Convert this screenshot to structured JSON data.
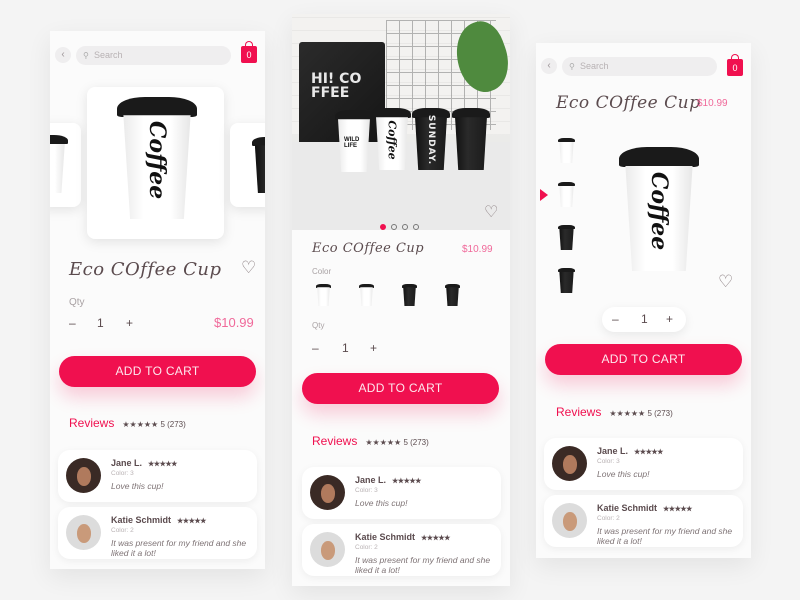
{
  "colors": {
    "accent": "#f0104f",
    "price": "#f0699a",
    "text": "#5b4b4e",
    "muted": "#a9a2a4",
    "background": "#f4f4f4"
  },
  "common": {
    "search_placeholder": "Search",
    "cart_count": "0",
    "back_icon": "‹",
    "search_icon": "⚲",
    "heart_icon": "♡",
    "product_title": "Eco COffee Cup",
    "price": "$10.99",
    "qty_label": "Qty",
    "qty_value": "1",
    "minus": "–",
    "plus": "+",
    "color_label": "Color",
    "add_to_cart": "ADD TO CART",
    "reviews_title": "Reviews",
    "reviews_summary": "★★★★★ 5 (273)"
  },
  "cup_labels": {
    "coffee": "Coffee",
    "sunday": "SUNDAY.",
    "wild": "WILD LIFE",
    "brand": "☕ ···"
  },
  "hero": {
    "bag_text": "HI! CO FFEE",
    "pages": 4,
    "active_page": 1
  },
  "reviews": [
    {
      "name": "Jane L.",
      "stars": "★★★★★",
      "color": "Color: 3",
      "text": "Love this cup!"
    },
    {
      "name": "Katie Schmidt",
      "stars": "★★★★★",
      "color": "Color: 2",
      "text": "It was present for my friend and she liked it a lot!"
    }
  ],
  "variants": [
    "Wild Life white cup",
    "Coffee white cup",
    "Sunday black cup",
    "Brand black cup"
  ],
  "selected_variant": 2
}
